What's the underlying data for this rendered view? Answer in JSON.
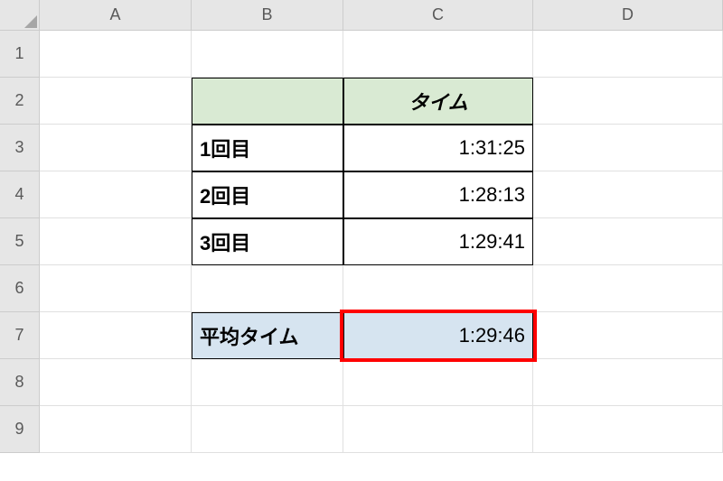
{
  "columns": {
    "A": "A",
    "B": "B",
    "C": "C",
    "D": "D"
  },
  "rows": {
    "r1": "1",
    "r2": "2",
    "r3": "3",
    "r4": "4",
    "r5": "5",
    "r6": "6",
    "r7": "7",
    "r8": "8",
    "r9": "9"
  },
  "table": {
    "headerTime": "タイム",
    "row1": {
      "label": "1回目",
      "value": "1:31:25"
    },
    "row2": {
      "label": "2回目",
      "value": "1:28:13"
    },
    "row3": {
      "label": "3回目",
      "value": "1:29:41"
    },
    "avg": {
      "label": "平均タイム",
      "value": "1:29:46"
    }
  }
}
